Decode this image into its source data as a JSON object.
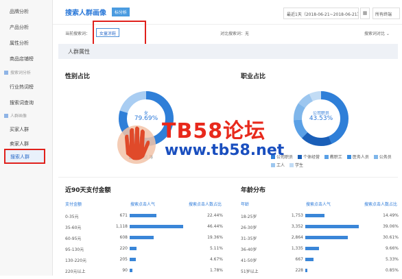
{
  "sidebar": {
    "items_top": [
      "品牌分析",
      "产品分析",
      "属性分析",
      "商品店铺榜"
    ],
    "section1": "搜索词分析",
    "items_mid": [
      "行业热词榜",
      "搜索词查询"
    ],
    "section2": "人群画像",
    "items_bot": [
      "买家人群",
      "卖家人群"
    ],
    "active": "搜索人群"
  },
  "header": {
    "title": "搜索人群画像",
    "tag": "标分析",
    "date_range": "最近1天（2018-06-21~2018-06-21）",
    "device": "所有终端"
  },
  "filter": {
    "label": "当前搜索词：",
    "chip": "女童凉鞋",
    "compare": "对比搜索词：无",
    "right": "搜索词对比"
  },
  "band_title": "人群属性",
  "gender": {
    "title": "性别占比",
    "center_label": "女",
    "center_value": "79.69%",
    "legend": [
      {
        "label": "女",
        "color": "#2f7fd8"
      },
      {
        "label": "男",
        "color": "#a9cdf2"
      }
    ]
  },
  "occupation": {
    "title": "职业占比",
    "center_label": "公司职员",
    "center_value": "43.53%",
    "legend": [
      {
        "label": "公司职员",
        "color": "#2f7fd8"
      },
      {
        "label": "个体经营",
        "color": "#1a5fb8"
      },
      {
        "label": "教职工",
        "color": "#5aa0e6"
      },
      {
        "label": "医务人员",
        "color": "#3b8ee0"
      },
      {
        "label": "公务员",
        "color": "#7fb6ea"
      },
      {
        "label": "工人",
        "color": "#9cc6ef"
      },
      {
        "label": "学生",
        "color": "#c2dcf5"
      }
    ]
  },
  "payment": {
    "title": "近90天支付金额",
    "headers": [
      "支付金额",
      "搜索点击人气",
      "搜索点击人数占比"
    ],
    "rows": [
      {
        "label": "0-35元",
        "value": "671",
        "pct": "22.44%",
        "frac": 0.5
      },
      {
        "label": "35-60元",
        "value": "1,118",
        "pct": "46.44%",
        "frac": 1.0
      },
      {
        "label": "60-95元",
        "value": "608",
        "pct": "19.36%",
        "frac": 0.45
      },
      {
        "label": "95-130元",
        "value": "220",
        "pct": "5.11%",
        "frac": 0.13
      },
      {
        "label": "130-220元",
        "value": "205",
        "pct": "4.67%",
        "frac": 0.12
      },
      {
        "label": "220元以上",
        "value": "90",
        "pct": "1.78%",
        "frac": 0.05
      }
    ]
  },
  "age": {
    "title": "年龄分布",
    "headers": [
      "年龄",
      "搜索点击人气",
      "搜索点击人数占比"
    ],
    "rows": [
      {
        "label": "18-25岁",
        "value": "1,753",
        "pct": "14.49%",
        "frac": 0.36
      },
      {
        "label": "26-30岁",
        "value": "3,352",
        "pct": "39.06%",
        "frac": 1.0
      },
      {
        "label": "31-35岁",
        "value": "2,864",
        "pct": "30.61%",
        "frac": 0.8
      },
      {
        "label": "36-40岁",
        "value": "1,335",
        "pct": "9.66%",
        "frac": 0.26
      },
      {
        "label": "41-50岁",
        "value": "667",
        "pct": "5.33%",
        "frac": 0.15
      },
      {
        "label": "51岁以上",
        "value": "228",
        "pct": "0.85%",
        "frac": 0.03
      }
    ]
  },
  "watermark": {
    "line1": "TB58论坛",
    "line2": "www.tb58.net"
  }
}
